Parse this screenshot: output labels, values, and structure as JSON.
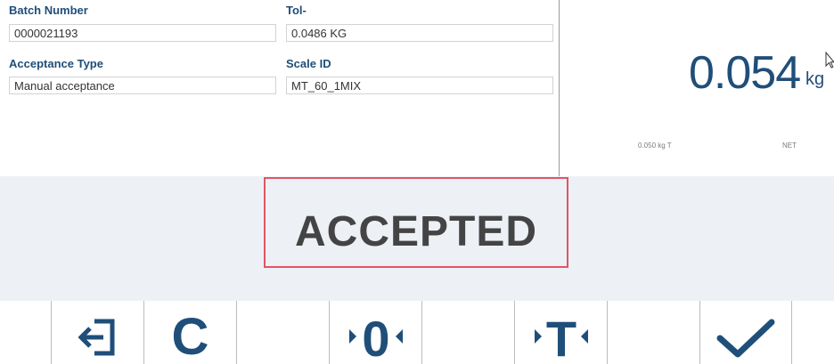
{
  "form": {
    "batch_number_label": "Batch Number",
    "batch_number_value": "0000021193",
    "tol_minus_label": "Tol-",
    "tol_minus_value": "0.0486 KG",
    "acceptance_type_label": "Acceptance Type",
    "acceptance_type_value": "Manual acceptance",
    "scale_id_label": "Scale ID",
    "scale_id_value": "MT_60_1MIX"
  },
  "weight": {
    "value": "0.054",
    "unit": "kg",
    "tare": "0.050 kg T",
    "mode": "NET"
  },
  "status": {
    "text": "ACCEPTED"
  },
  "softkeys": {
    "clear_label": "C",
    "zero_label": "0",
    "tare_label": "T"
  },
  "icons": {
    "exit": "exit-icon",
    "checkmark": "checkmark-icon",
    "cursor": "mouse-cursor-icon"
  },
  "colors": {
    "accent": "#1f4e79",
    "status_border": "#e05565",
    "status_band": "#edf1f6"
  }
}
